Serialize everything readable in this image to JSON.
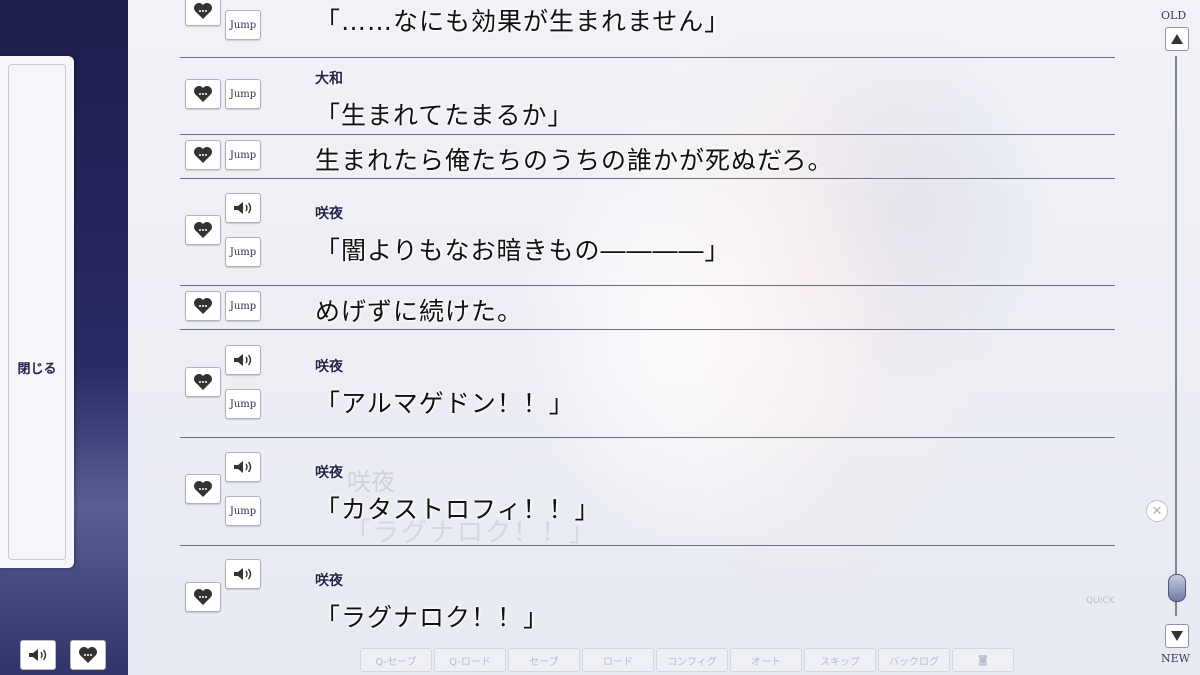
{
  "sidebar": {
    "close_label": "閉じる"
  },
  "log": [
    {
      "speaker": "",
      "text": "「……なにも効果が生まれません」",
      "has_voice": false,
      "jump_label": "Jump"
    },
    {
      "speaker": "大和",
      "text": "「生まれてたまるか」",
      "has_voice": false,
      "jump_label": "Jump"
    },
    {
      "speaker": "",
      "text": "生まれたら俺たちのうちの誰かが死ぬだろ。",
      "has_voice": false,
      "jump_label": "Jump"
    },
    {
      "speaker": "咲夜",
      "text": "「闇よりもなお暗きもの――――」",
      "has_voice": true,
      "jump_label": "Jump"
    },
    {
      "speaker": "",
      "text": "めげずに続けた。",
      "has_voice": false,
      "jump_label": "Jump"
    },
    {
      "speaker": "咲夜",
      "text": "「アルマゲドン！！」",
      "has_voice": true,
      "jump_label": "Jump"
    },
    {
      "speaker": "咲夜",
      "text": "「カタストロフィ！！」",
      "has_voice": true,
      "jump_label": "Jump"
    },
    {
      "speaker": "咲夜",
      "text": "「ラグナロク！！」",
      "has_voice": true,
      "jump_label": ""
    }
  ],
  "scrollbar": {
    "top_label": "OLD",
    "bottom_label": "NEW",
    "position": 0.97
  },
  "background": {
    "faint_name": "咲夜",
    "faint_line": "「ラグナロク！！」",
    "quick_label": "QUICK"
  },
  "menu": [
    "Q-セーブ",
    "Q-ロード",
    "セーブ",
    "ロード",
    "コンフィグ",
    "オート",
    "スキップ",
    "バックログ"
  ],
  "colors": {
    "sidebar": "#1d1f4c",
    "divider": "#6a6c80",
    "text": "#111111"
  }
}
